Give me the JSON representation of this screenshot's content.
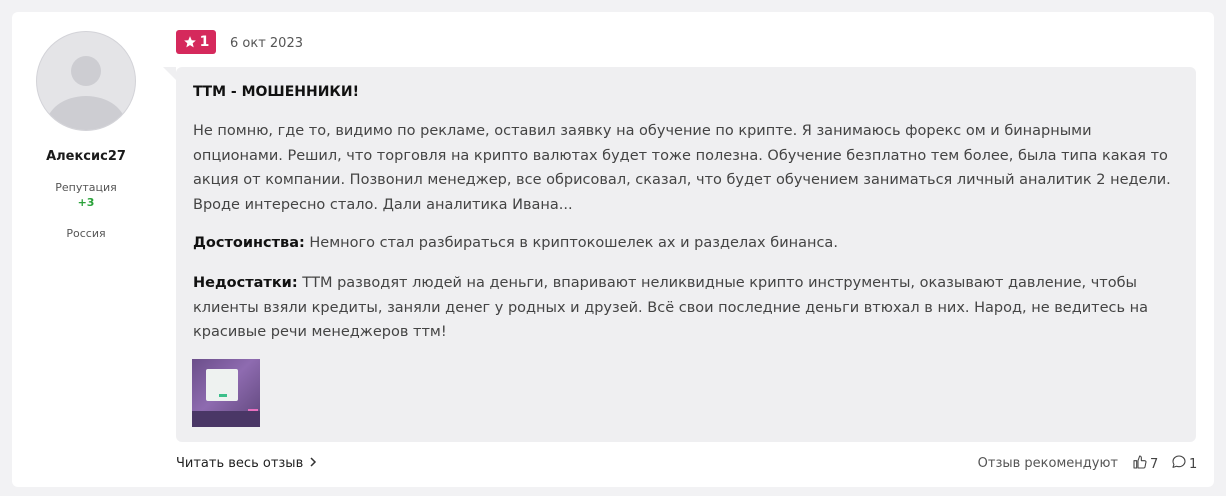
{
  "author": {
    "name": "Алексис27",
    "reputation_label": "Репутация",
    "reputation_value": "+3",
    "country": "Россия"
  },
  "review": {
    "rating": "1",
    "date": "6 окт 2023",
    "title": "ТТМ - МОШЕННИКИ!",
    "text": "Не помню, где то, видимо по рекламе, оставил заявку на обучение по крипте. Я занимаюсь форекс ом и бинарными опционами. Решил, что торговля на крипто валютах будет тоже полезна. Обучение безплатно тем более, была типа какая то акция от компании. Позвонил менеджер, все обрисовал, сказал, что будет обучением заниматься личный аналитик 2 недели. Вроде интересно стало. Дали аналитика Ивана...",
    "pros_label": "Достоинства:",
    "pros_text": "Немного стал разбираться в криптокошелек ах и разделах бинанса.",
    "cons_label": "Недостатки:",
    "cons_text": "ТТМ разводят людей на деньги, впаривают неликвидные крипто инструменты, оказывают давление, чтобы клиенты взяли кредиты, заняли денег у родных и друзей. Всё свои последние деньги втюхал в них. Народ, не ведитесь на красивые речи менеджеров ттм!"
  },
  "footer": {
    "read_more": "Читать весь отзыв",
    "recommend": "Отзыв рекомендуют",
    "likes": "7",
    "comments": "1"
  },
  "colors": {
    "badge": "#d5295c",
    "reputation": "#2aa23a",
    "review_bg": "#efeff1"
  },
  "icons": {
    "rating": "star-icon",
    "read_more": "chevron-right-icon",
    "likes": "thumbs-up-icon",
    "comments": "comment-icon"
  }
}
